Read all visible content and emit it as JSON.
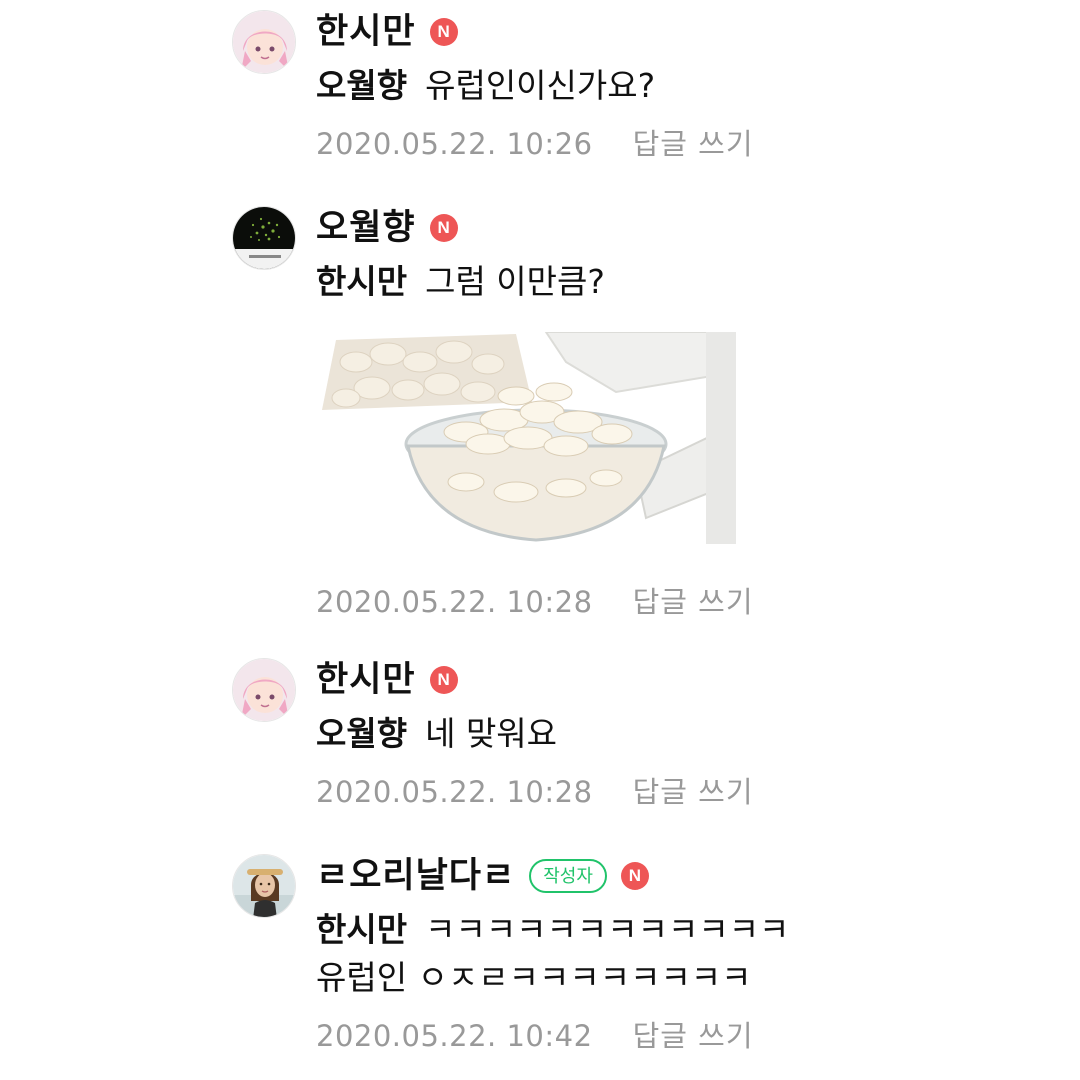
{
  "comments": [
    {
      "author": "한시만",
      "n_badge": "N",
      "mention": "오월향",
      "text": "유럽인이신가요?",
      "date": "2020.05.22. 10:26",
      "reply": "답글 쓰기"
    },
    {
      "author": "오월향",
      "n_badge": "N",
      "mention": "한시만",
      "text": "그럼 이만큼?",
      "date": "2020.05.22. 10:28",
      "reply": "답글 쓰기"
    },
    {
      "author": "한시만",
      "n_badge": "N",
      "mention": "오월향",
      "text": "네 맞워요",
      "date": "2020.05.22. 10:28",
      "reply": "답글 쓰기"
    },
    {
      "author": "ㄹ오리날다ㄹ",
      "writer_badge": "작성자",
      "n_badge": "N",
      "mention": "한시만",
      "text": "ㅋㅋㅋㅋㅋㅋㅋㅋㅋㅋㅋㅋ",
      "text2": "유럽인 ㅇㅈㄹㅋㅋㅋㅋㅋㅋㅋㅋ",
      "date": "2020.05.22. 10:42",
      "reply": "답글 쓰기"
    }
  ],
  "colors": {
    "n_badge": "#ee5656",
    "writer_badge": "#20c36a",
    "meta_text": "#999999"
  },
  "icons": [
    "profile-avatar-pink-hair",
    "profile-avatar-dark",
    "profile-avatar-photo",
    "n-badge-icon"
  ]
}
